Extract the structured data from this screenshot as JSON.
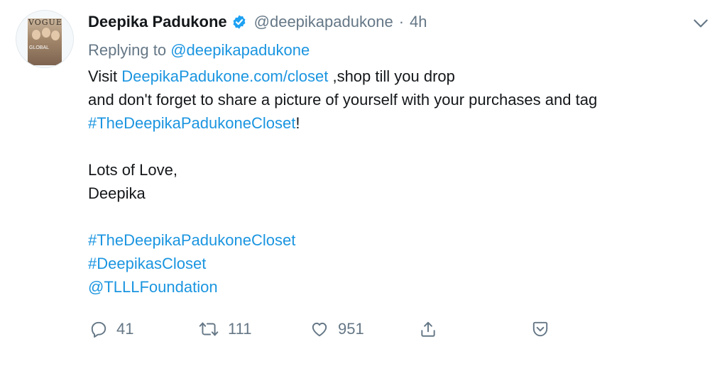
{
  "author": {
    "name": "Deepika Padukone",
    "handle": "@deepikapadukone",
    "separator": "·",
    "time": "4h",
    "avatar_cover": {
      "masthead": "VOGUE",
      "tagline": "GLOBAL"
    }
  },
  "reply": {
    "prefix": "Replying to",
    "target": "@deepikapadukone"
  },
  "body": {
    "line1_prefix": "Visit ",
    "line1_link": "DeepikaPadukone.com/closet",
    "line1_suffix": " ,shop till you drop",
    "line2": "and don't forget to share a picture of yourself with your purchases and tag",
    "line3_hashtag": "#TheDeepikaPadukoneCloset",
    "line3_suffix": "!",
    "line5": "Lots of Love,",
    "line6": "Deepika",
    "tag1": "#TheDeepikaPadukoneCloset",
    "tag2": "#DeepikasCloset",
    "mention": "@TLLLFoundation"
  },
  "actions": {
    "reply_count": "41",
    "retweet_count": "111",
    "like_count": "951"
  },
  "colors": {
    "link": "#1b95e0",
    "verified": "#1da1f2",
    "secondary_text": "#657786",
    "primary_text": "#14171a"
  },
  "icons": [
    "chevron-down-icon",
    "verified-badge-icon",
    "reply-icon",
    "retweet-icon",
    "like-icon",
    "share-icon",
    "bookmark-icon"
  ]
}
